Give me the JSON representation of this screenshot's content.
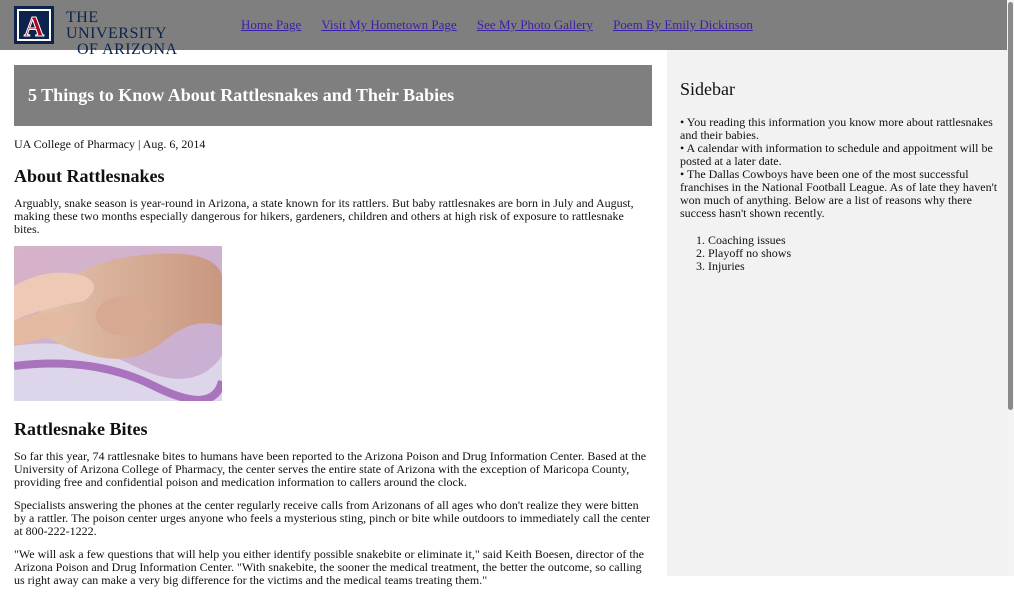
{
  "header": {
    "logo_line1": "THE UNIVERSITY",
    "logo_line2": "OF ARIZONA",
    "logo_mark": "A",
    "nav": [
      "Home Page",
      "Visit My Hometown Page",
      "See My Photo Gallery",
      "Poem By Emily Dickinson"
    ]
  },
  "article": {
    "title": "5 Things to Know About Rattlesnakes and Their Babies",
    "byline": "UA College of Pharmacy | Aug. 6, 2014",
    "section1_title": "About Rattlesnakes",
    "section1_para": "Arguably, snake season is year-round in Arizona, a state known for its rattlers. But baby rattlesnakes are born in July and August, making these two months especially dangerous for hikers, gardeners, children and others at high risk of exposure to rattlesnake bites.",
    "section2_title": "Rattlesnake Bites",
    "section2_paras": [
      "So far this year, 74 rattlesnake bites to humans have been reported to the Arizona Poison and Drug Information Center. Based at the University of Arizona College of Pharmacy, the center serves the entire state of Arizona with the exception of Maricopa County, providing free and confidential poison and medication information to callers around the clock.",
      "Specialists answering the phones at the center regularly receive calls from Arizonans of all ages who don't realize they were bitten by a rattler. The poison center urges anyone who feels a mysterious sting, pinch or bite while outdoors to immediately call the center at 800-222-1222.",
      "\"We will ask a few questions that will help you either identify possible snakebite or eliminate it,\" said Keith Boesen, director of the Arizona Poison and Drug Information Center. \"With snakebite, the sooner the medical treatment, the better the outcome, so calling us right away can make a very big difference for the victims and the medical teams treating them.\""
    ]
  },
  "sidebar": {
    "title": "Sidebar",
    "items": [
      "You reading this information you know more about rattlesnakes and their babies.",
      "A calendar with information to schedule and appoitment will be posted at a later date.",
      "The Dallas Cowboys have been one of the most successful franchises in the National Football League. As of late they haven't won much of anything. Below are a list of reasons why there success hasn't shown recently."
    ],
    "reasons": [
      "Coaching issues",
      "Playoff no shows",
      "Injuries"
    ]
  },
  "colors": {
    "header_bg": "#7f7f7f",
    "hero_bg": "#7f7f7f",
    "sidebar_bg": "#f2f2f2",
    "link": "#3b1fa8",
    "brand_navy": "#0c234b",
    "brand_red": "#ab0520"
  }
}
